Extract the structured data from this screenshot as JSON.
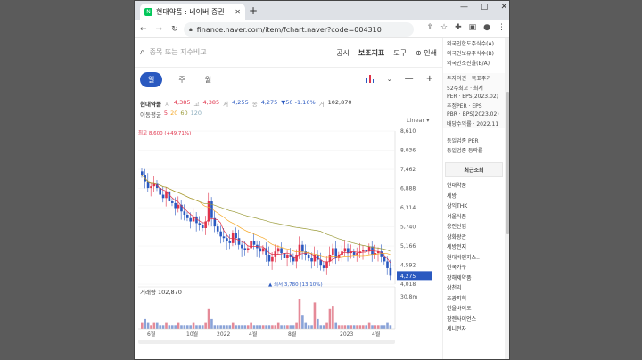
{
  "browser": {
    "tab_title": "현대약품 : 네이버 증권",
    "tab_favicon": "N",
    "new_tab": "+",
    "url": "finance.naver.com/item/fchart.naver?code=004310",
    "window_controls": [
      "—",
      "▢",
      "✕"
    ]
  },
  "search": {
    "placeholder": "종목 또는 지수비교"
  },
  "top_menu": [
    "공시",
    "보조지표",
    "도구",
    "⊕ 인쇄"
  ],
  "period_tabs": {
    "active": "일",
    "others": [
      "주",
      "월"
    ]
  },
  "stock_info": {
    "name": "현대약품",
    "open_label": "시",
    "open": "4,385",
    "high_label": "고",
    "high": "4,385",
    "low_label": "저",
    "low": "4,255",
    "close_label": "종",
    "close": "4,275",
    "change": "▼50 -1.16%",
    "volume_label": "거",
    "volume": "102,870"
  },
  "moving_avg": {
    "label": "이동평균",
    "values": [
      "5",
      "20",
      "60",
      "120"
    ],
    "colors": [
      "#e0324a",
      "#f5a623",
      "#9b9b3a",
      "#9aa"
    ]
  },
  "scale_mode": "Linear ▾",
  "chart_data": {
    "type": "candlestick",
    "price_axis": [
      "8,610",
      "8,036",
      "7,462",
      "6,888",
      "6,314",
      "5,740",
      "5,166",
      "4,592",
      "4,018"
    ],
    "ylim": [
      4018,
      8610
    ],
    "x_ticks": [
      "6월",
      "10월",
      "2022",
      "4월",
      "8월",
      "2023",
      "4월"
    ],
    "current_price_label": "4,275",
    "max_annotation": "최고 8,600 (+49.71%)",
    "min_annotation": "▲ 최저 3,780 (13.10%)",
    "volume_label": "거래량",
    "volume_value": "102,870",
    "volume_axis": "30.8m",
    "close_series": [
      7300,
      7100,
      6900,
      6950,
      7050,
      6900,
      6700,
      6600,
      6800,
      6500,
      6450,
      6300,
      6400,
      6200,
      6100,
      6000,
      5900,
      6050,
      5850,
      5800,
      5700,
      5900,
      6500,
      6000,
      5750,
      5600,
      5450,
      5400,
      5300,
      5250,
      5550,
      5400,
      5200,
      5100,
      5050,
      5100,
      5300,
      5200,
      5100,
      5000,
      5100,
      4900,
      4700,
      4850,
      5000,
      5100,
      4950,
      4800,
      4900,
      4850,
      4700,
      4900,
      5200,
      5000,
      4900,
      4800,
      4700,
      4900,
      4750,
      4600,
      4500,
      4700,
      4900,
      5100,
      4800,
      4900,
      5000,
      5100,
      4950,
      5000,
      4900,
      4950,
      5000,
      5050,
      5000,
      5150,
      4900,
      4950,
      5000,
      4850,
      4700,
      4500,
      4275
    ],
    "volume_series": [
      2,
      3,
      2,
      1,
      2,
      2,
      1,
      1,
      2,
      1,
      1,
      1,
      2,
      1,
      1,
      1,
      1,
      2,
      1,
      1,
      1,
      2,
      6,
      3,
      1,
      1,
      1,
      1,
      1,
      1,
      2,
      1,
      1,
      1,
      1,
      1,
      2,
      1,
      1,
      1,
      1,
      1,
      1,
      1,
      1,
      2,
      1,
      1,
      1,
      1,
      1,
      2,
      9,
      4,
      2,
      1,
      1,
      8,
      3,
      1,
      1,
      2,
      6,
      7,
      2,
      1,
      1,
      1,
      1,
      1,
      1,
      1,
      1,
      1,
      1,
      2,
      1,
      1,
      1,
      1,
      1,
      2,
      1
    ]
  },
  "sidebar": {
    "top_items": [
      "외국인한도주식수(A)",
      "외국인보유주식수(B)",
      "외국인소진율(B/A)"
    ],
    "metrics": [
      "투자의견 · 목표주가",
      "52주최고 · 최저",
      "PER · EPS(2023.02)",
      "추정PER · EPS",
      "PBR · BPS(2023.02)",
      "배당수익률 · 2022.11"
    ],
    "sector": [
      "동일업종 PER",
      "동일업종 등락률"
    ],
    "recent_header": "최근조회",
    "recent_items": [
      "현대약품",
      "세방",
      "삼익THK",
      "서울식품",
      "웅진산업",
      "삼화왕관",
      "세방전지",
      "현대비앤지스..",
      "한국가구",
      "장해제약품",
      "삼천리",
      "조광피혁",
      "한올바이오",
      "팜젠사이언스",
      "세니전자"
    ]
  }
}
